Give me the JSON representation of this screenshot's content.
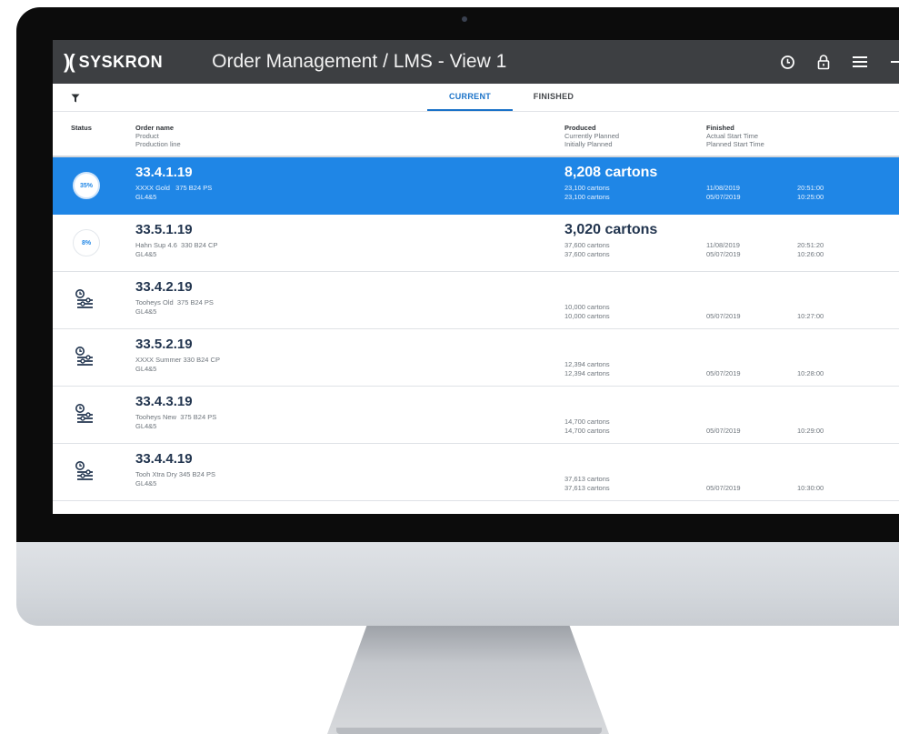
{
  "app": {
    "logo_text": "SYSKRON",
    "title": "Order Management / LMS  -  View 1"
  },
  "tabs": [
    {
      "label": "CURRENT",
      "active": true
    },
    {
      "label": "FINISHED",
      "active": false
    }
  ],
  "columns": {
    "status": "Status",
    "order": [
      "Order name",
      "Product",
      "Production line"
    ],
    "produced": [
      "Produced",
      "Currently Planned",
      "Initially Planned"
    ],
    "finished": [
      "Finished",
      "Actual Start Time",
      "Planned Start Time"
    ]
  },
  "colors": {
    "accent": "#1f86e6",
    "titlebar": "#3d3f42",
    "order_text": "#22354f"
  },
  "orders": [
    {
      "name": "33.4.1.19",
      "product": "XXXX Gold   375 B24 PS",
      "line": "GL4&5",
      "status": "progress",
      "progress": "35%",
      "produced": "8,208 cartons",
      "currently_planned": "23,100 cartons",
      "initially_planned": "23,100 cartons",
      "actual_start_date": "11/08/2019",
      "actual_start_time": "20:51:00",
      "planned_start_date": "05/07/2019",
      "planned_start_time": "10:25:00",
      "selected": true
    },
    {
      "name": "33.5.1.19",
      "product": "Hahn Sup 4.6  330 B24 CP",
      "line": "GL4&5",
      "status": "progress",
      "progress": "8%",
      "produced": "3,020 cartons",
      "currently_planned": "37,600 cartons",
      "initially_planned": "37,600 cartons",
      "actual_start_date": "11/08/2019",
      "actual_start_time": "20:51:20",
      "planned_start_date": "05/07/2019",
      "planned_start_time": "10:26:00",
      "selected": false
    },
    {
      "name": "33.4.2.19",
      "product": "Tooheys Old  375 B24 PS",
      "line": "GL4&5",
      "status": "scheduled",
      "currently_planned": "10,000 cartons",
      "initially_planned": "10,000 cartons",
      "planned_start_date": "05/07/2019",
      "planned_start_time": "10:27:00"
    },
    {
      "name": "33.5.2.19",
      "product": "XXXX Summer 330 B24 CP",
      "line": "GL4&5",
      "status": "scheduled",
      "currently_planned": "12,394 cartons",
      "initially_planned": "12,394 cartons",
      "planned_start_date": "05/07/2019",
      "planned_start_time": "10:28:00"
    },
    {
      "name": "33.4.3.19",
      "product": "Tooheys New  375 B24 PS",
      "line": "GL4&5",
      "status": "scheduled",
      "currently_planned": "14,700 cartons",
      "initially_planned": "14,700 cartons",
      "planned_start_date": "05/07/2019",
      "planned_start_time": "10:29:00"
    },
    {
      "name": "33.4.4.19",
      "product": "Tooh Xtra Dry 345 B24 PS",
      "line": "GL4&5",
      "status": "scheduled",
      "currently_planned": "37,613 cartons",
      "initially_planned": "37,613 cartons",
      "planned_start_date": "05/07/2019",
      "planned_start_time": "10:30:00"
    }
  ],
  "icons": {
    "filter": "filter-icon",
    "clock": "clock-icon",
    "lock": "lock-icon",
    "menu": "menu-icon",
    "scheduled": "schedule-sliders-icon"
  }
}
